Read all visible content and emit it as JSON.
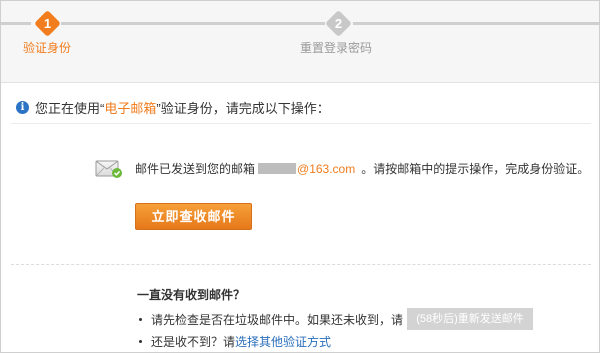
{
  "steps": [
    {
      "number": "1",
      "label": "验证身份",
      "state": "active"
    },
    {
      "number": "2",
      "label": "重置登录密码",
      "state": "pending"
    }
  ],
  "notice": {
    "prefix": "您正在使用“",
    "method": "电子邮箱",
    "suffix": "”验证身份，请完成以下操作："
  },
  "mail": {
    "sent_text": "邮件已发送到您的邮箱",
    "email_domain": "@163.com",
    "instruction": "。请按邮箱中的提示操作，完成身份验证。",
    "button_label": "立即查收邮件"
  },
  "faq": {
    "title": "一直没有收到邮件？",
    "item1_text": "请先检查是否在垃圾邮件中。如果还未收到，请",
    "resend_label": "(58秒后)重新发送邮件",
    "item2_text": "还是收不到？请",
    "item2_link": "选择其他验证方式"
  },
  "colors": {
    "accent": "#f17d1e",
    "link": "#2a6ebb",
    "disabled": "#d3d3d3"
  },
  "icons": {
    "info": "info-icon",
    "mail": "envelope-icon"
  }
}
